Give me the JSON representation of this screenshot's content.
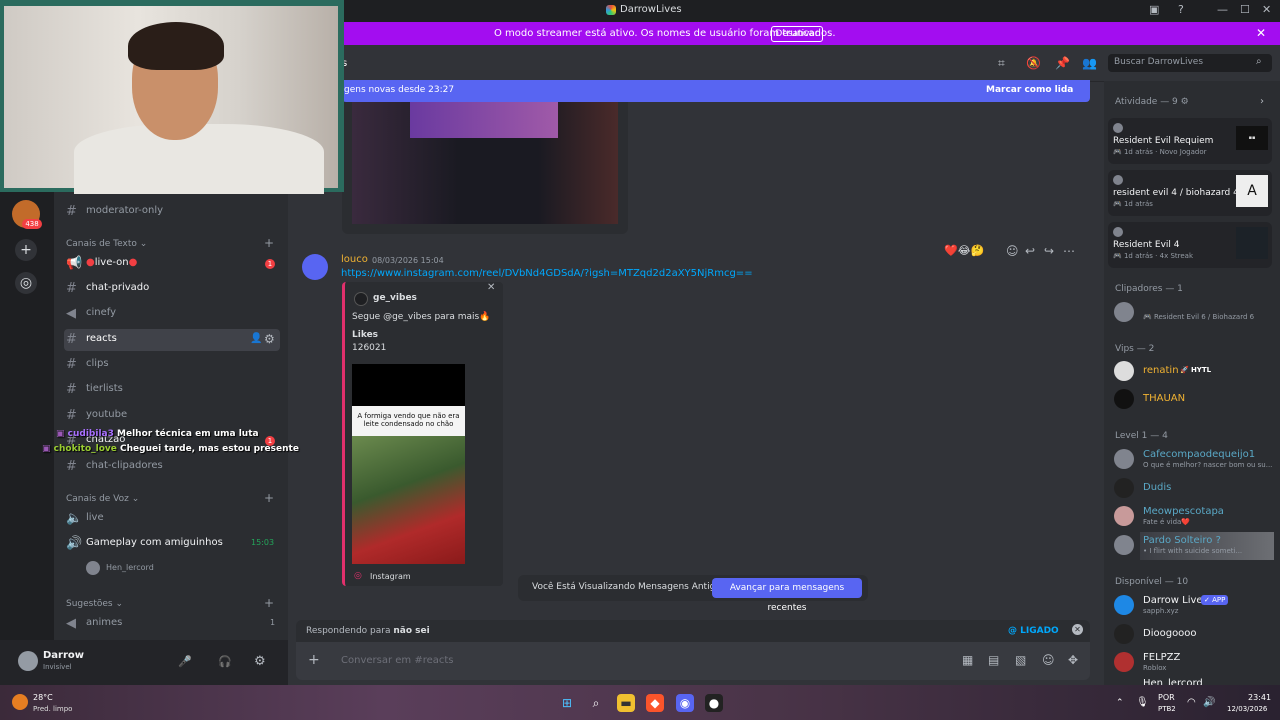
{
  "window": {
    "title": "DarrowLives",
    "controls": [
      "—",
      "☐",
      "✕"
    ]
  },
  "banner": {
    "message": "O modo streamer está ativo. Os nomes de usuário foram truncados.",
    "button": "Desativar"
  },
  "servers": {
    "mention_count": "438"
  },
  "channels": {
    "moderator": "moderator-only",
    "text_category": "Canais de Texto",
    "live_on": "live-on",
    "live_badge": "1",
    "items": [
      "chat-privado",
      "cinefy",
      "reacts",
      "clips",
      "tierlists",
      "youtube",
      "chatzao",
      "chat-clipadores"
    ],
    "chatzao_badge": "1",
    "voice_category": "Canais de Voz",
    "voice_live": "live",
    "voice_gameplay": "Gameplay com amiguinhos",
    "voice_time": "15:03",
    "voice_user": "Hen_lercord",
    "suggestions_category": "Sugestões",
    "suggestion_item": "animes",
    "suggestion_badge": "1"
  },
  "user": {
    "name": "Darrow",
    "status": "Invisível"
  },
  "header": {
    "channel_fragment": "s",
    "search_placeholder": "Buscar DarrowLives"
  },
  "newbar": {
    "text": "gens novas desde 23:27",
    "action": "Marcar como lida"
  },
  "message": {
    "author": "louco",
    "timestamp": "08/03/2026 15:04",
    "link": "https://www.instagram.com/reel/DVbNd4GDSdA/?igsh=MTZqd2d2aXY5NjRmcg==",
    "embed": {
      "account": "ge_vibes",
      "description": "Segue @ge_vibes para mais🔥",
      "likes_label": "Likes",
      "likes_value": "126021",
      "image_caption": "A formiga vendo que não era leite condensado no chão",
      "footer": "Instagram"
    }
  },
  "jump": {
    "text": "Você Está Visualizando Mensagens Antigas",
    "button": "Avançar para mensagens recentes"
  },
  "reply": {
    "prefix": "Respondendo para ",
    "target": "não sei",
    "mention": "@ LIGADO"
  },
  "composer": {
    "placeholder": "Conversar em #reacts"
  },
  "members": {
    "activity_header": "Atividade — 9",
    "activities": [
      {
        "game": "Resident Evil Requiem",
        "time": "1d atrás",
        "extra": "Novo Jogador"
      },
      {
        "game": "resident evil 4 / biohazard 4",
        "time": "1d atrás",
        "extra": ""
      },
      {
        "game": "Resident Evil 4",
        "time": "1d atrás",
        "extra": "4x Streak"
      }
    ],
    "clippers_header": "Clipadores — 1",
    "clipper_sub": "Resident Evil 6 / Biohazard 6",
    "vips_header": "Vips — 2",
    "vip1": "renatin",
    "vip1_tag": "HYTL",
    "vip2": "THAUAN",
    "level_header": "Level 1 — 4",
    "level_members": [
      {
        "name": "Cafecompaodequeijo1",
        "sub": "O que é melhor? nascer bom ou su..."
      },
      {
        "name": "Dudis",
        "sub": ""
      },
      {
        "name": "Meowpescotapa",
        "sub": "Fate é vida❤️"
      },
      {
        "name": "Pardo Solteiro ?",
        "sub": "• I flirt with suicide someti..."
      }
    ],
    "available_header": "Disponível — 10",
    "available": [
      {
        "name": "Darrow Live",
        "tag": "✓ APP",
        "sub": "sapph.xyz"
      },
      {
        "name": "Dioogoooo",
        "sub": ""
      },
      {
        "name": "FELPZZ",
        "sub": "Roblox"
      },
      {
        "name": "Hen_lercord",
        "sub": ""
      }
    ]
  },
  "overlay_chat": [
    {
      "user": "cudibila3",
      "text": "Melhor técnica em uma luta"
    },
    {
      "user": "chokito_love",
      "text": "Cheguei tarde, mas estou presente"
    }
  ],
  "taskbar": {
    "weather_temp": "28°C",
    "weather_desc": "Pred. limpo",
    "lang": "POR",
    "kb": "PTB2",
    "time": "23:41",
    "date": "12/03/2026"
  },
  "colors": {
    "accent": "#5865f2",
    "banner": "#a30df0",
    "link": "#00a8fc",
    "author": "#f0b232"
  }
}
